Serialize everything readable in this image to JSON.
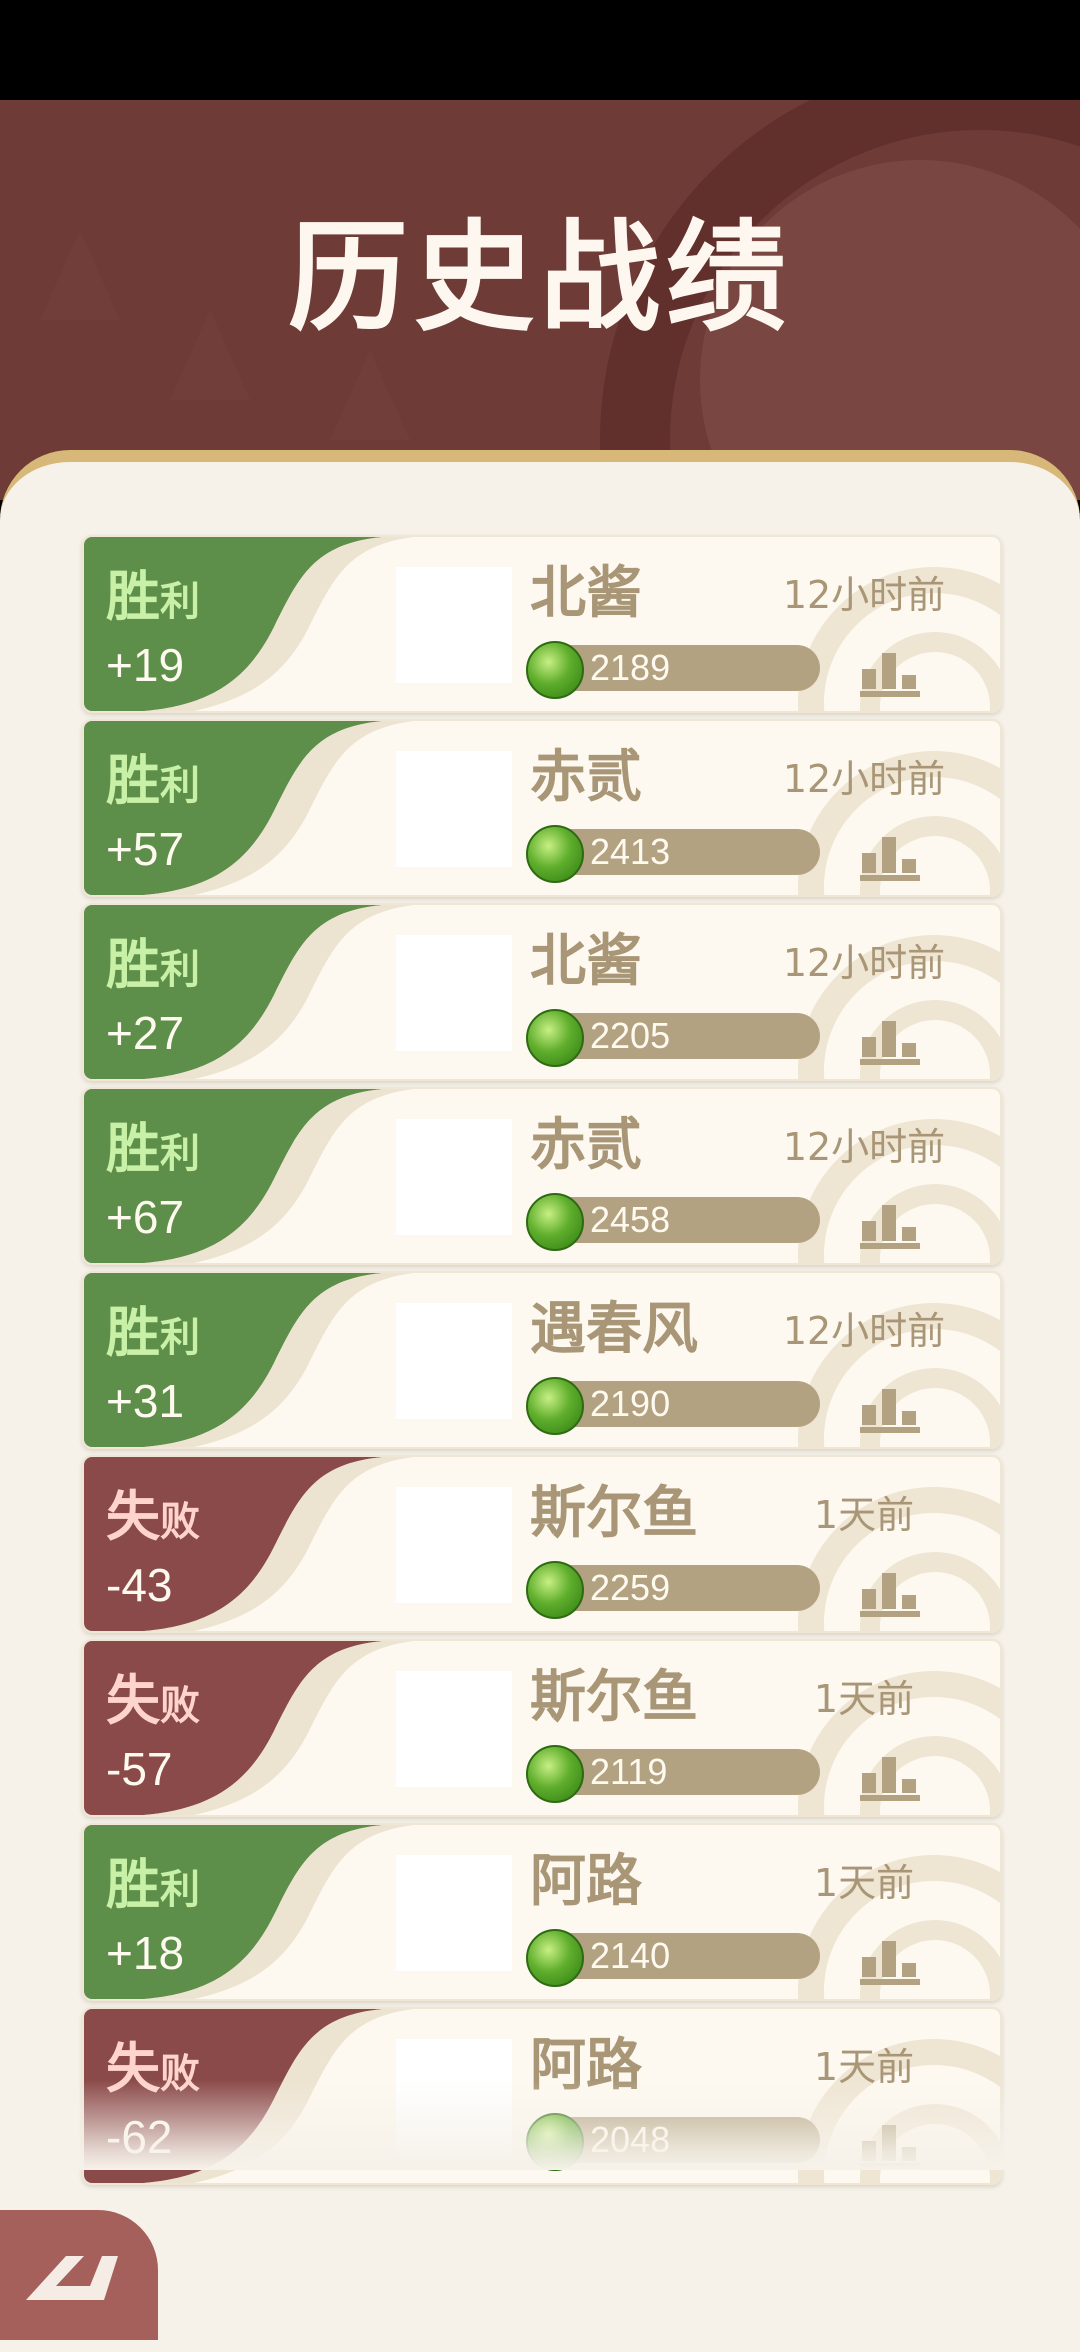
{
  "header": {
    "title": "历史战绩"
  },
  "colors": {
    "win": "#5d8e4a",
    "loss": "#8b4a4a",
    "header_bg": "#6e3b37",
    "content_bg": "#f6f2ea",
    "text_muted": "#a89677"
  },
  "records": [
    {
      "result": "win",
      "label_big": "胜",
      "label_small": "利",
      "score": "+19",
      "opponent": "北酱",
      "rating": "2189",
      "time": "12小时前"
    },
    {
      "result": "win",
      "label_big": "胜",
      "label_small": "利",
      "score": "+57",
      "opponent": "赤贰",
      "rating": "2413",
      "time": "12小时前"
    },
    {
      "result": "win",
      "label_big": "胜",
      "label_small": "利",
      "score": "+27",
      "opponent": "北酱",
      "rating": "2205",
      "time": "12小时前"
    },
    {
      "result": "win",
      "label_big": "胜",
      "label_small": "利",
      "score": "+67",
      "opponent": "赤贰",
      "rating": "2458",
      "time": "12小时前"
    },
    {
      "result": "win",
      "label_big": "胜",
      "label_small": "利",
      "score": "+31",
      "opponent": "遇春风",
      "rating": "2190",
      "time": "12小时前"
    },
    {
      "result": "loss",
      "label_big": "失",
      "label_small": "败",
      "score": "-43",
      "opponent": "斯尔鱼",
      "rating": "2259",
      "time": "1天前"
    },
    {
      "result": "loss",
      "label_big": "失",
      "label_small": "败",
      "score": "-57",
      "opponent": "斯尔鱼",
      "rating": "2119",
      "time": "1天前"
    },
    {
      "result": "win",
      "label_big": "胜",
      "label_small": "利",
      "score": "+18",
      "opponent": "阿路",
      "rating": "2140",
      "time": "1天前"
    },
    {
      "result": "loss",
      "label_big": "失",
      "label_small": "败",
      "score": "-62",
      "opponent": "阿路",
      "rating": "2048",
      "time": "1天前"
    }
  ],
  "icons": {
    "rating": "green-gem-icon",
    "rank": "bar-chart-icon",
    "back": "back-arrow-icon"
  }
}
